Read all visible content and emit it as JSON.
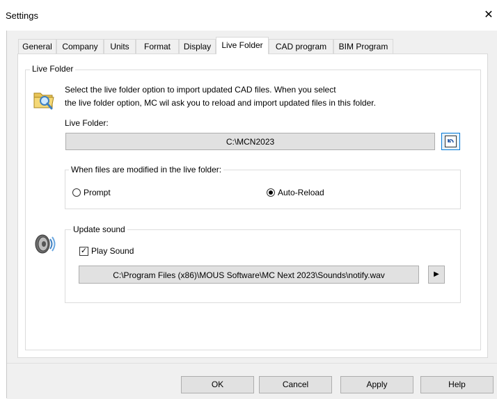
{
  "window": {
    "title": "Settings",
    "close_glyph": "✕"
  },
  "tabs": [
    {
      "label": "General"
    },
    {
      "label": "Company"
    },
    {
      "label": "Units"
    },
    {
      "label": "Format"
    },
    {
      "label": "Display"
    },
    {
      "label": "Live Folder",
      "active": true
    },
    {
      "label": "CAD program"
    },
    {
      "label": "BIM Program"
    }
  ],
  "live_folder": {
    "group_title": "Live Folder",
    "description_line1": "Select the live folder option to import updated CAD files. When you select",
    "description_line2": "the live folder option, MC wil ask you to reload and import updated files in this folder.",
    "folder_label": "Live Folder:",
    "folder_value": "C:\\MCN2023",
    "browse_icon": "undo-arrow-icon",
    "modified_group_title": "When files are modified in the live folder:",
    "option_prompt": "Prompt",
    "option_auto_reload": "Auto-Reload",
    "selected_option": "Auto-Reload"
  },
  "update_sound": {
    "group_title": "Update sound",
    "play_sound_label": "Play Sound",
    "play_sound_checked": true,
    "sound_path": "C:\\Program Files (x86)\\MOUS Software\\MC Next 2023\\Sounds\\notify.wav",
    "play_glyph": "▶"
  },
  "buttons": {
    "ok": "OK",
    "cancel": "Cancel",
    "apply": "Apply",
    "help": "Help"
  }
}
